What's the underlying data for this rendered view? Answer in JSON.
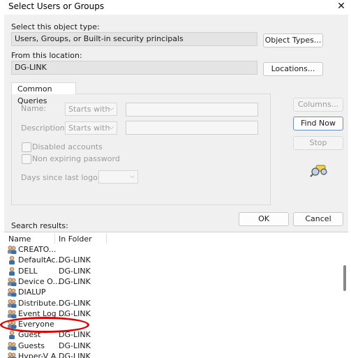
{
  "window": {
    "title": "Select Users or Groups",
    "close_glyph": "✕"
  },
  "object_type": {
    "label": "Select this object type:",
    "value": "Users, Groups, or Built-in security principals",
    "button": "Object Types..."
  },
  "location": {
    "label": "From this location:",
    "value": "DG-LINK",
    "button": "Locations..."
  },
  "queries": {
    "tab": "Common Queries",
    "name_label": "Name:",
    "name_mode": "Starts with",
    "description_label": "Description:",
    "description_mode": "Starts with",
    "disabled_accounts": "Disabled accounts",
    "non_expiring": "Non expiring password",
    "days_label": "Days since last logon:"
  },
  "side_buttons": {
    "columns": "Columns...",
    "find_now": "Find Now",
    "stop": "Stop"
  },
  "footer": {
    "ok": "OK",
    "cancel": "Cancel",
    "results_label": "Search results:"
  },
  "results": {
    "columns": [
      "Name",
      "In Folder"
    ],
    "rows": [
      {
        "name": "CREATO...",
        "folder": "",
        "icon": "group-icon"
      },
      {
        "name": "DefaultAc...",
        "folder": "DG-LINK",
        "icon": "user-icon"
      },
      {
        "name": "DELL",
        "folder": "DG-LINK",
        "icon": "user-icon"
      },
      {
        "name": "Device O...",
        "folder": "DG-LINK",
        "icon": "group-icon"
      },
      {
        "name": "DIALUP",
        "folder": "",
        "icon": "group-icon"
      },
      {
        "name": "Distribute...",
        "folder": "DG-LINK",
        "icon": "group-icon"
      },
      {
        "name": "Event Log ...",
        "folder": "DG-LINK",
        "icon": "group-icon"
      },
      {
        "name": "Everyone",
        "folder": "",
        "icon": "group-icon"
      },
      {
        "name": "Guest",
        "folder": "DG-LINK",
        "icon": "user-icon"
      },
      {
        "name": "Guests",
        "folder": "DG-LINK",
        "icon": "group-icon"
      },
      {
        "name": "Hyper-V A...",
        "folder": "DG-LINK",
        "icon": "group-icon"
      }
    ]
  },
  "colors": {
    "dialog_bg": "#f0f0f0",
    "annotation": "#e00000",
    "primary_border": "#6a8fc6"
  }
}
